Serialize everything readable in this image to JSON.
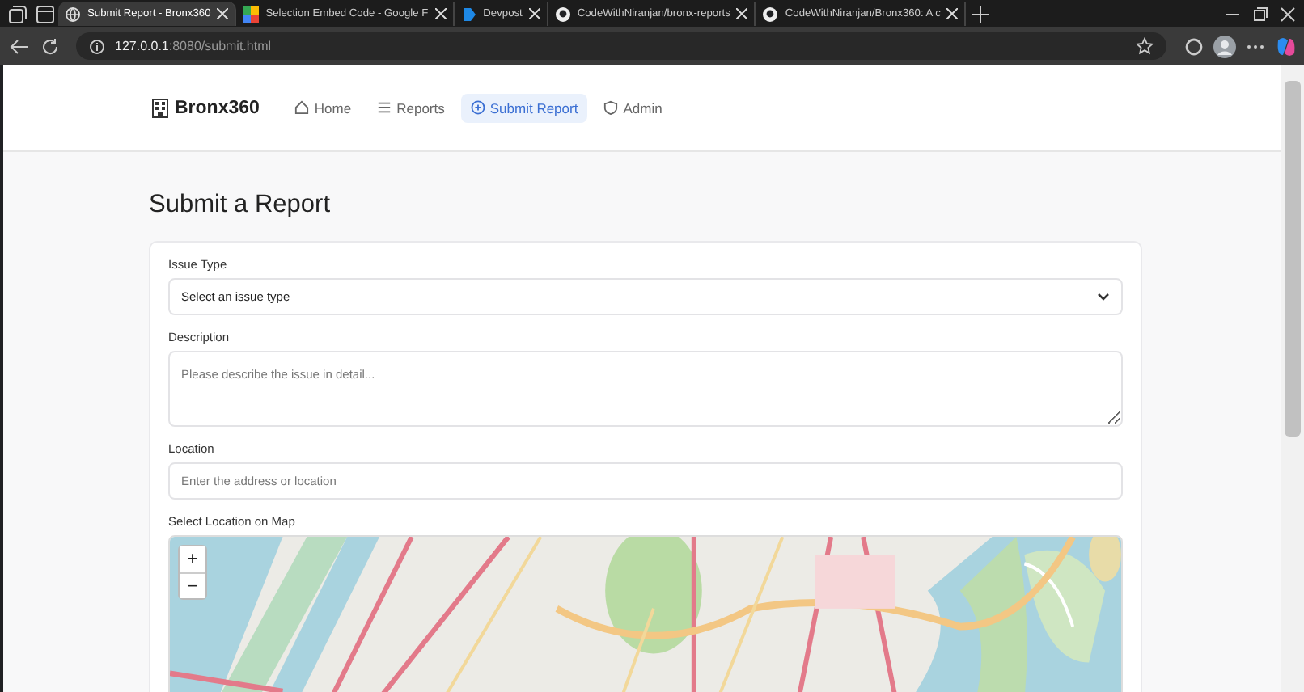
{
  "browser": {
    "tabs": [
      {
        "title": "Submit Report - Bronx360",
        "selected": true
      },
      {
        "title": "Selection Embed Code - Google F",
        "selected": false
      },
      {
        "title": "Devpost",
        "selected": false
      },
      {
        "title": "CodeWithNiranjan/bronx-reports",
        "selected": false
      },
      {
        "title": "CodeWithNiranjan/Bronx360: A c",
        "selected": false
      }
    ],
    "address": {
      "host": "127.0.0.1",
      "path": ":8080/submit.html"
    }
  },
  "navbar": {
    "brand": "Bronx360",
    "links": [
      {
        "label": "Home",
        "selected": false
      },
      {
        "label": "Reports",
        "selected": false
      },
      {
        "label": "Submit Report",
        "selected": true
      },
      {
        "label": "Admin",
        "selected": false
      }
    ]
  },
  "page_title": "Submit a Report",
  "form": {
    "fields": [
      {
        "kind": "select",
        "label": "Issue Type",
        "value": "Select an issue type"
      },
      {
        "kind": "textarea",
        "label": "Description",
        "placeholder": "Please describe the issue in detail..."
      },
      {
        "kind": "input",
        "label": "Location",
        "placeholder": "Enter the address or location"
      },
      {
        "kind": "map",
        "label": "Select Location on Map",
        "zoom_in": "+",
        "zoom_out": "−"
      }
    ]
  }
}
